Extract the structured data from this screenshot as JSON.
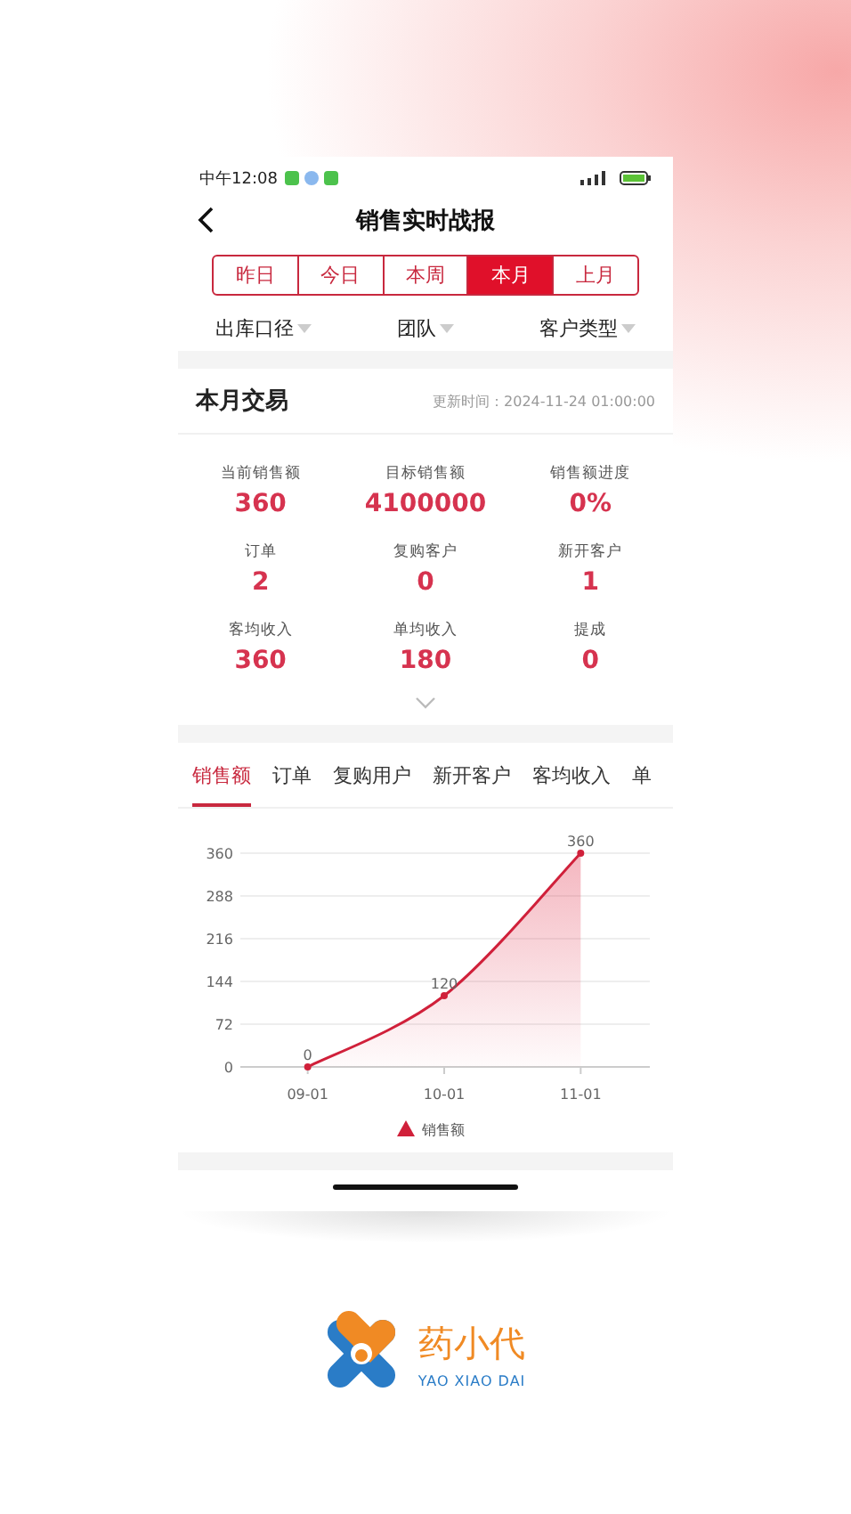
{
  "status_bar": {
    "time": "中午12:08"
  },
  "header": {
    "title": "销售实时战报"
  },
  "period_tabs": [
    {
      "label": "昨日",
      "selected": false
    },
    {
      "label": "今日",
      "selected": false
    },
    {
      "label": "本周",
      "selected": false
    },
    {
      "label": "本月",
      "selected": true
    },
    {
      "label": "上月",
      "selected": false
    }
  ],
  "filters": [
    "出库口径",
    "团队",
    "客户类型"
  ],
  "summary": {
    "title": "本月交易",
    "updated": "更新时间：2024-11-24 01:00:00",
    "stats": [
      {
        "label": "当前销售额",
        "value": "360"
      },
      {
        "label": "目标销售额",
        "value": "4100000"
      },
      {
        "label": "销售额进度",
        "value": "0%"
      },
      {
        "label": "订单",
        "value": "2"
      },
      {
        "label": "复购客户",
        "value": "0"
      },
      {
        "label": "新开客户",
        "value": "1"
      },
      {
        "label": "客均收入",
        "value": "360"
      },
      {
        "label": "单均收入",
        "value": "180"
      },
      {
        "label": "提成",
        "value": "0"
      }
    ]
  },
  "chart_tabs": [
    {
      "label": "销售额",
      "selected": true
    },
    {
      "label": "订单",
      "selected": false
    },
    {
      "label": "复购用户",
      "selected": false
    },
    {
      "label": "新开客户",
      "selected": false
    },
    {
      "label": "客均收入",
      "selected": false
    },
    {
      "label": "单",
      "selected": false
    }
  ],
  "chart_data": {
    "type": "area",
    "categories": [
      "09-01",
      "10-01",
      "11-01"
    ],
    "series": [
      {
        "name": "销售额",
        "color": "#d0203a",
        "values": [
          0,
          120,
          360
        ]
      }
    ],
    "ylim": [
      0,
      360
    ],
    "grid": true,
    "yticks": [
      0,
      72,
      144,
      216,
      288,
      360
    ],
    "data_labels": true
  },
  "brand": {
    "name": "药小代",
    "tagline": "YAO XIAO DAI"
  }
}
